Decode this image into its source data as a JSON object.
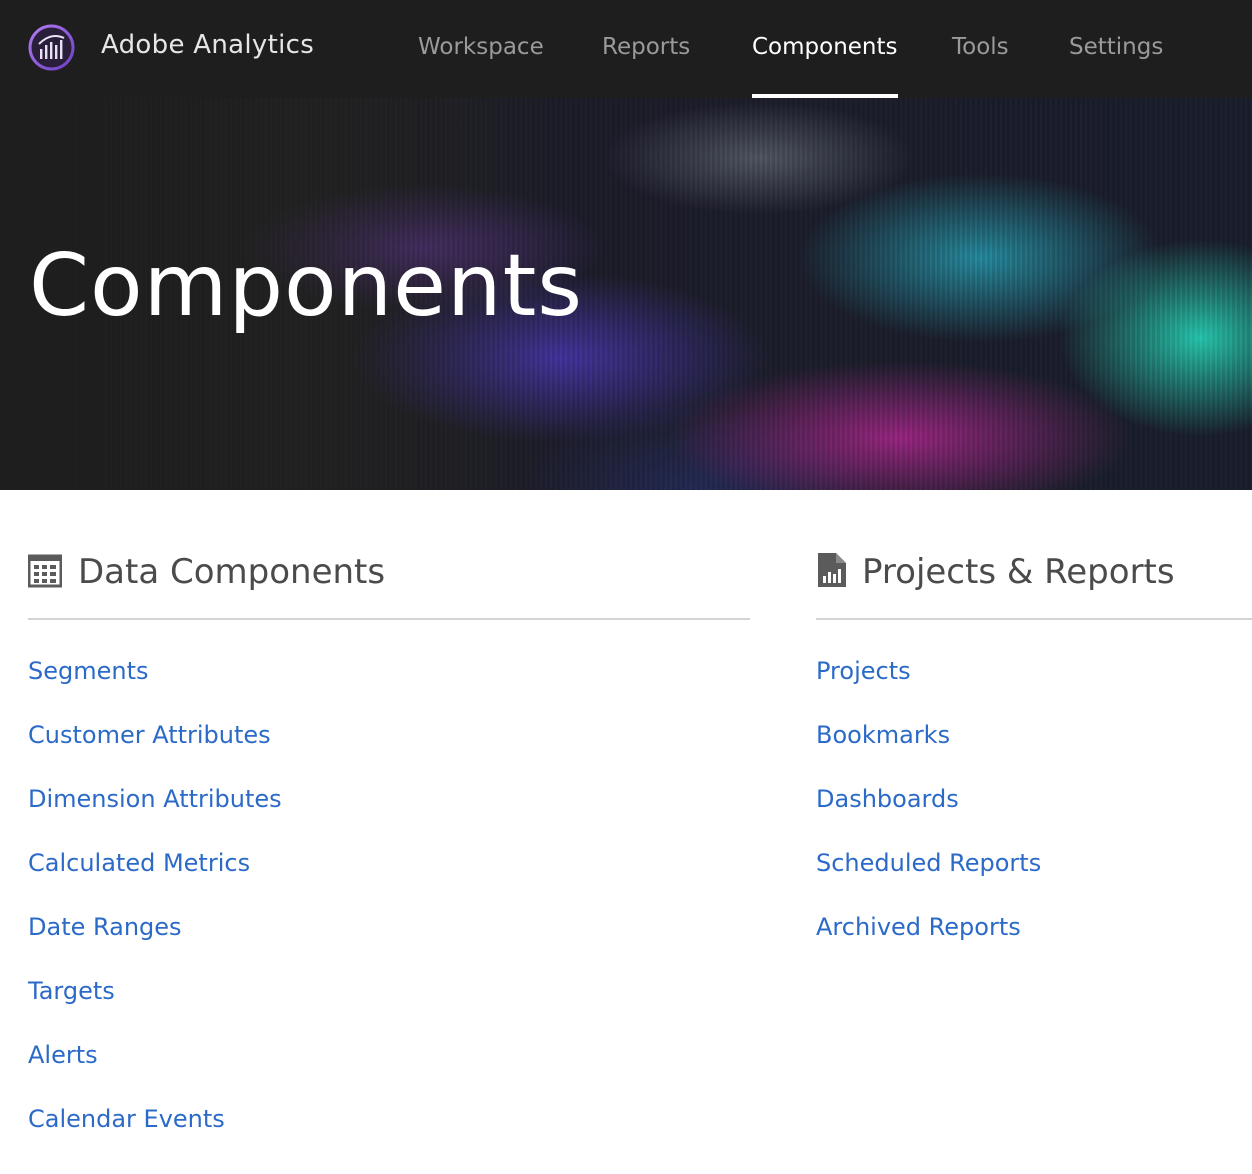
{
  "app": {
    "title": "Adobe Analytics",
    "logo_icon": "adobe-analytics-logo-icon",
    "accent_color": "#8a5cd6"
  },
  "nav": {
    "tabs": [
      {
        "label": "Workspace",
        "active": false
      },
      {
        "label": "Reports",
        "active": false
      },
      {
        "label": "Components",
        "active": true
      },
      {
        "label": "Tools",
        "active": false
      },
      {
        "label": "Settings",
        "active": false
      }
    ]
  },
  "hero": {
    "title": "Components"
  },
  "sections": {
    "data_components": {
      "title": "Data Components",
      "icon": "table-grid-icon",
      "links": [
        {
          "label": "Segments"
        },
        {
          "label": "Customer Attributes"
        },
        {
          "label": "Dimension Attributes"
        },
        {
          "label": "Calculated Metrics"
        },
        {
          "label": "Date Ranges"
        },
        {
          "label": "Targets"
        },
        {
          "label": "Alerts"
        },
        {
          "label": "Calendar Events"
        }
      ]
    },
    "projects_reports": {
      "title": "Projects & Reports",
      "icon": "report-document-icon",
      "links": [
        {
          "label": "Projects"
        },
        {
          "label": "Bookmarks"
        },
        {
          "label": "Dashboards"
        },
        {
          "label": "Scheduled Reports"
        },
        {
          "label": "Archived Reports"
        }
      ]
    }
  },
  "colors": {
    "topbar_bg": "#1e1e1e",
    "link": "#2c6ac8",
    "section_title": "#4b4b4b",
    "divider": "#d4d4d4"
  }
}
